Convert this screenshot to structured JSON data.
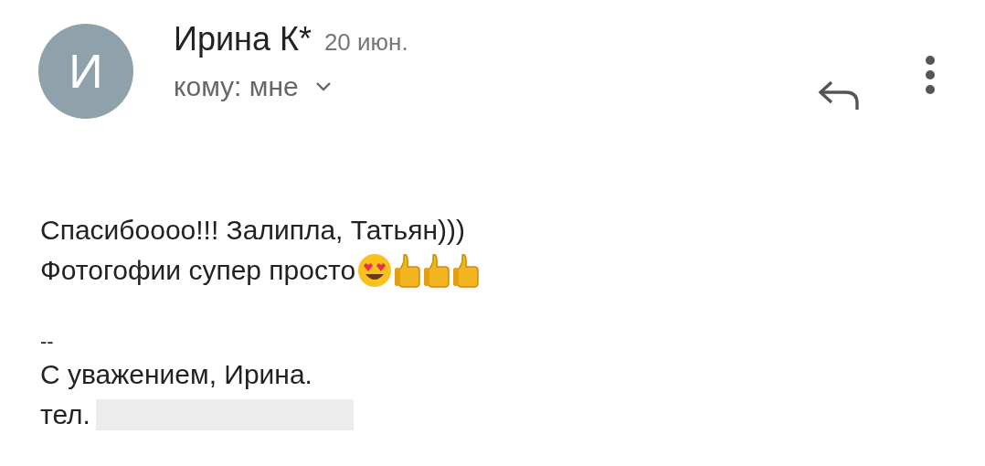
{
  "header": {
    "avatar_initial": "И",
    "sender": "Ирина К*",
    "date": "20 июн.",
    "recipient": "кому: мне"
  },
  "body": {
    "lines": [
      "Спасибоооо!!! Залипла, Татьян)))",
      "Фотогофии супер просто"
    ],
    "emoji": [
      {
        "kind": "heart-eyes"
      },
      {
        "kind": "thumbs-up"
      },
      {
        "kind": "thumbs-up"
      },
      {
        "kind": "thumbs-up"
      }
    ]
  },
  "signature": {
    "separator": "--",
    "closing": "С уважением, Ирина.",
    "phone_label": "тел.",
    "phone_redacted": true
  }
}
